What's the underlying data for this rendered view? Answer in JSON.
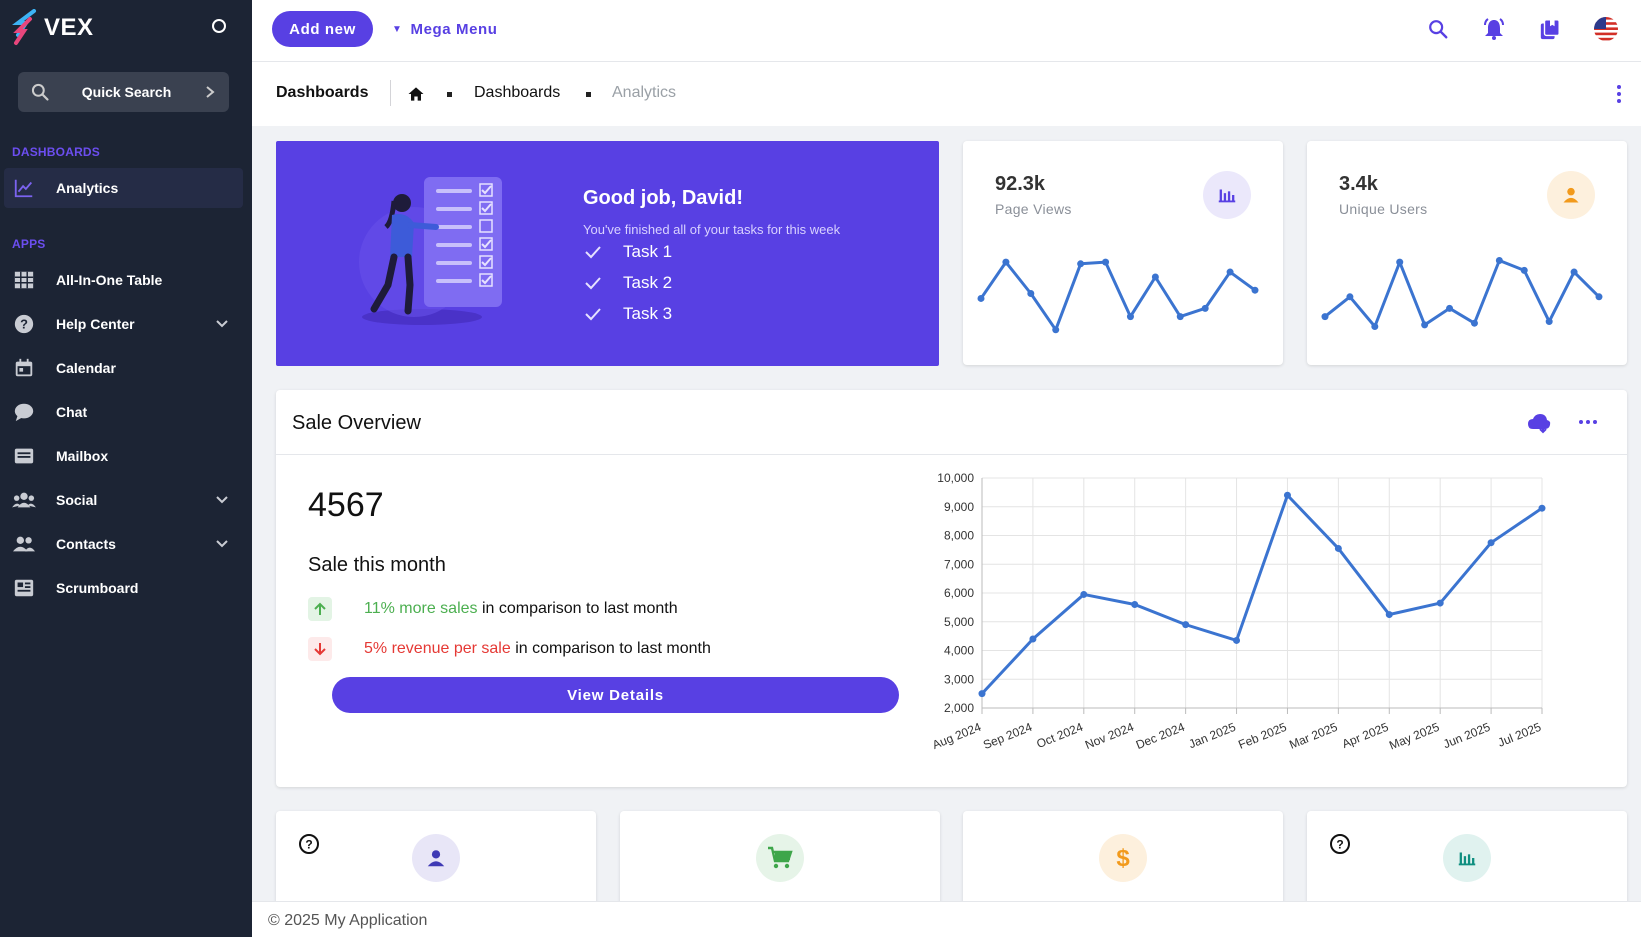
{
  "colors": {
    "accent": "#5840e3",
    "sidebar_bg": "#1c2434",
    "line": "#3b74d0",
    "positive": "#4caf50",
    "negative": "#e53935"
  },
  "sidebar": {
    "brand": "VEX",
    "quick_search": "Quick Search",
    "sections": [
      {
        "label": "DASHBOARDS"
      },
      {
        "label": "APPS"
      }
    ],
    "items": [
      {
        "label": "Analytics",
        "icon": "chart-line-icon",
        "active": true
      },
      {
        "label": "All-In-One Table",
        "icon": "grid-icon"
      },
      {
        "label": "Help Center",
        "icon": "help-icon",
        "expandable": true
      },
      {
        "label": "Calendar",
        "icon": "calendar-icon"
      },
      {
        "label": "Chat",
        "icon": "chat-icon"
      },
      {
        "label": "Mailbox",
        "icon": "mailbox-icon"
      },
      {
        "label": "Social",
        "icon": "social-icon",
        "expandable": true
      },
      {
        "label": "Contacts",
        "icon": "contacts-icon",
        "expandable": true
      },
      {
        "label": "Scrumboard",
        "icon": "scrumboard-icon"
      }
    ]
  },
  "topbar": {
    "add_new": "Add new",
    "mega_menu": "Mega Menu",
    "icons": [
      "search-icon",
      "bell-icon",
      "bookmarks-icon",
      "us-flag-icon"
    ]
  },
  "breadcrumb": {
    "title": "Dashboards",
    "items": [
      "Dashboards",
      "Analytics"
    ]
  },
  "hero": {
    "title": "Good job, David!",
    "subtitle": "You've finished all of your tasks for this week",
    "tasks": [
      "Task 1",
      "Task 2",
      "Task 3"
    ]
  },
  "stats": [
    {
      "value": "92.3k",
      "label": "Page Views",
      "icon": "bar-chart-icon",
      "spark": [
        5.2,
        7.4,
        5.5,
        3.3,
        7.3,
        7.4,
        4.1,
        6.5,
        4.1,
        4.6,
        6.8,
        5.7
      ]
    },
    {
      "value": "3.4k",
      "label": "Unique Users",
      "icon": "person-icon",
      "spark": [
        4.1,
        5.3,
        3.5,
        7.4,
        3.6,
        4.6,
        3.7,
        7.5,
        6.9,
        3.8,
        6.8,
        5.3
      ]
    }
  ],
  "sale": {
    "title": "Sale Overview",
    "number": "4567",
    "caption": "Sale this month",
    "trend_up": {
      "highlight": "11% more sales",
      "rest": " in comparison to last month"
    },
    "trend_down": {
      "highlight": "5% revenue per sale",
      "rest": " in comparison to last month"
    },
    "button": "View Details"
  },
  "chart_data": {
    "type": "line",
    "categories": [
      "Aug 2024",
      "Sep 2024",
      "Oct 2024",
      "Nov 2024",
      "Dec 2024",
      "Jan 2025",
      "Feb 2025",
      "Mar 2025",
      "Apr 2025",
      "May 2025",
      "Jun 2025",
      "Jul 2025"
    ],
    "series": [
      {
        "values": [
          2500,
          4400,
          5950,
          5600,
          4900,
          4350,
          9400,
          7550,
          5250,
          5650,
          7750,
          8950
        ]
      }
    ],
    "ylim": [
      2000,
      10000
    ],
    "yticks": [
      2000,
      3000,
      4000,
      5000,
      6000,
      7000,
      8000,
      9000,
      10000
    ],
    "ytick_labels": [
      "2,000",
      "3,000",
      "4,000",
      "5,000",
      "6,000",
      "7,000",
      "8,000",
      "9,000",
      "10,000"
    ],
    "grid": true
  },
  "mini_cards": [
    {
      "icon": "person-icon",
      "help": true,
      "badge_bg": "#e8e6f7",
      "icon_color": "#3f3ab5"
    },
    {
      "icon": "cart-icon",
      "help": false,
      "badge_bg": "#e6f4e8",
      "icon_color": "#3ea64a"
    },
    {
      "icon": "dollar-icon",
      "help": false,
      "badge_bg": "#fdf0dd",
      "icon_color": "#f29a1c"
    },
    {
      "icon": "bar-chart-icon",
      "help": true,
      "badge_bg": "#e0f2ef",
      "icon_color": "#0f8f80"
    }
  ],
  "footer": "© 2025 My Application"
}
